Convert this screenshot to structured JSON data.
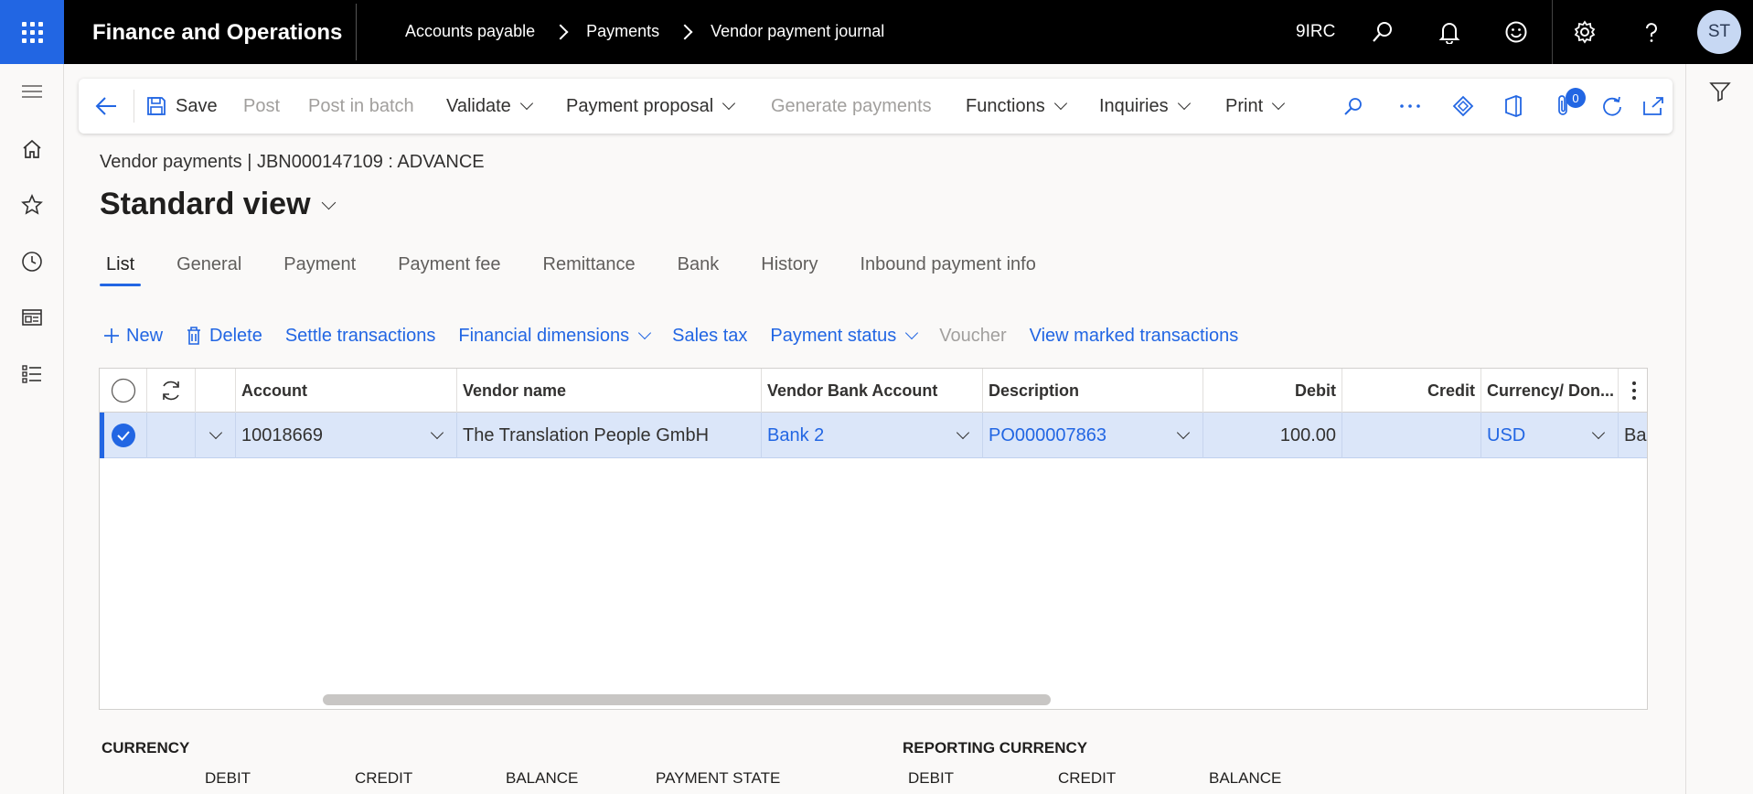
{
  "topbar": {
    "app_title": "Finance and Operations",
    "breadcrumb": [
      "Accounts payable",
      "Payments",
      "Vendor payment journal"
    ],
    "company": "9IRC",
    "avatar_initials": "ST"
  },
  "actionpane": {
    "save": "Save",
    "post": "Post",
    "post_in_batch": "Post in batch",
    "validate": "Validate",
    "payment_proposal": "Payment proposal",
    "generate_payments": "Generate payments",
    "functions": "Functions",
    "inquiries": "Inquiries",
    "print": "Print",
    "attachments_count": "0"
  },
  "page": {
    "caption": "Vendor payments   |   JBN000147109 : ADVANCE",
    "view_name": "Standard view"
  },
  "tabs": [
    "List",
    "General",
    "Payment",
    "Payment fee",
    "Remittance",
    "Bank",
    "History",
    "Inbound payment info"
  ],
  "grid_toolbar": {
    "new": "New",
    "delete": "Delete",
    "settle": "Settle transactions",
    "fin_dims": "Financial dimensions",
    "sales_tax": "Sales tax",
    "payment_status": "Payment status",
    "voucher": "Voucher",
    "view_marked": "View marked transactions"
  },
  "grid": {
    "columns": {
      "account": "Account",
      "vendor_name": "Vendor name",
      "vendor_bank": "Vendor Bank Account",
      "description": "Description",
      "debit": "Debit",
      "credit": "Credit",
      "currency": "Currency/ Don..."
    },
    "rows": [
      {
        "account": "10018669",
        "vendor_name": "The Translation People GmbH",
        "vendor_bank": "Bank 2",
        "description": "PO000007863",
        "debit": "100.00",
        "credit": "",
        "currency": "USD",
        "overflow": "Ba"
      }
    ]
  },
  "summary": {
    "currency_header": "CURRENCY",
    "reporting_header": "REPORTING CURRENCY",
    "debit": "DEBIT",
    "credit": "CREDIT",
    "balance": "BALANCE",
    "payment_state": "PAYMENT STATE"
  },
  "colors": {
    "accent": "#2266e3",
    "selected_row": "#dbe6f9",
    "topbar": "#000000"
  }
}
